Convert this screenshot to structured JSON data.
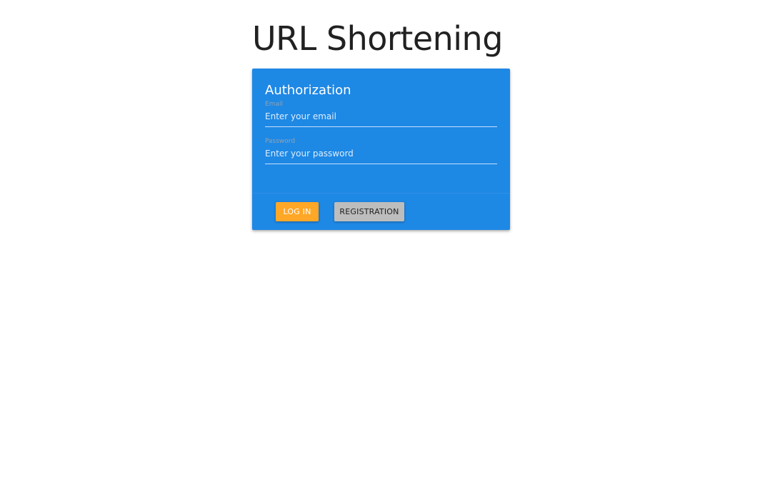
{
  "page": {
    "title": "URL Shortening"
  },
  "auth_card": {
    "title": "Authorization",
    "email": {
      "label": "Email",
      "placeholder": "Enter your email",
      "value": ""
    },
    "password": {
      "label": "Password",
      "placeholder": "Enter your password",
      "value": ""
    },
    "actions": {
      "login_label": "Log in",
      "register_label": "Registration"
    }
  },
  "colors": {
    "card_background": "#1e88e5",
    "field_label": "#90a4ae",
    "login_button": "#ffa726",
    "register_button": "#bdbdbd",
    "title_text": "#212121"
  }
}
